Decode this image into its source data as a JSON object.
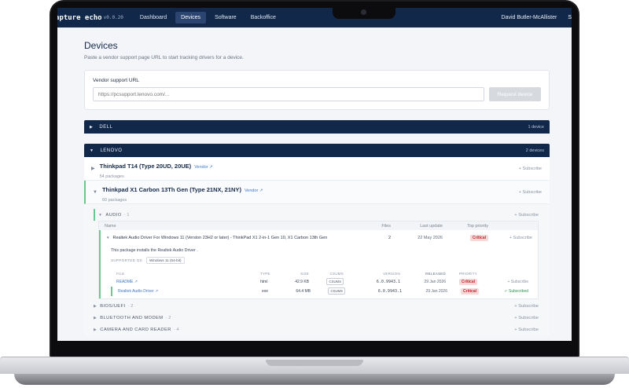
{
  "nav": {
    "brand": "apture echo",
    "version": "v0.0.20",
    "links": [
      "Dashboard",
      "Devices",
      "Software",
      "Backoffice"
    ],
    "active": "Devices",
    "user": "David Butler-McAllister",
    "user_extra": "S"
  },
  "page": {
    "title": "Devices",
    "subtitle": "Paste a vendor support page URL to start tracking drivers for a device."
  },
  "url_card": {
    "label": "Vendor support URL",
    "placeholder": "https://pcsupport.lenovo.com/...",
    "button": "Request device"
  },
  "vendors": [
    {
      "name": "DELL",
      "count": "1 device",
      "expanded": false
    },
    {
      "name": "LENOVO",
      "count": "2 devices",
      "expanded": true
    }
  ],
  "models": [
    {
      "name": "Thinkpad T14 (Type 20UD, 20UE)",
      "vendor_link": "Vendor ↗",
      "packages": "54 packages",
      "subscribe": "+ Subscribe"
    },
    {
      "name": "Thinkpad X1 Carbon 13Th Gen (Type 21NX, 21NY)",
      "vendor_link": "Vendor ↗",
      "packages": "60 packages",
      "subscribe": "+ Subscribe"
    }
  ],
  "categories": [
    {
      "name": "AUDIO",
      "count": "· 1",
      "subscribe": "+ Subscribe"
    },
    {
      "name": "BIOS/UEFI",
      "count": "· 2",
      "subscribe": "+ Subscribe"
    },
    {
      "name": "BLUETOOTH AND MODEM",
      "count": "· 2",
      "subscribe": "+ Subscribe"
    },
    {
      "name": "CAMERA AND CARD READER",
      "count": "· 4",
      "subscribe": "+ Subscribe"
    }
  ],
  "package_table": {
    "headers": {
      "name": "Name",
      "files": "Files",
      "last_update": "Last update",
      "priority": "Top priority"
    },
    "package": {
      "name": "Realtek Audio Driver For Windows 11 (Version 23H2 or later) - ThinkPad X1 2-in-1 Gen 10, X1 Carbon 13th Gen",
      "files": "2",
      "last_update": "22 May 2026",
      "priority": "Critical",
      "subscribe": "+ Subscribe",
      "description": "This package installs the Realtek Audio Driver .",
      "supported_label": "SUPPORTED OS",
      "supported_os": "Windows 11 (64-bit)"
    },
    "file_headers": {
      "file": "FILE",
      "type": "TYPE",
      "size": "SIZE",
      "csums": "CSUMS",
      "version": "VERSION",
      "released": "RELEASED",
      "priority": "PRIORITY"
    },
    "files": [
      {
        "name": "README ↗",
        "type": "html",
        "size": "42.9 KB",
        "csums": "CSUMS",
        "version": "6.0.9943.1",
        "released": "29 Jan 2026",
        "priority": "Critical",
        "subscribe": "+ Subscribe"
      },
      {
        "name": "Realtek Audio Driver ↗",
        "type": "exe",
        "size": "64.4 MB",
        "csums": "CSUMS",
        "version": "6.0.9943.1",
        "released": "29 Jan 2026",
        "priority": "Critical",
        "subscribe": "✓ Subscribed"
      }
    ]
  },
  "colors": {
    "nav_bg": "#12284a",
    "accent_green": "#6bc78e",
    "critical": "#c2262b",
    "link": "#3d78c9"
  }
}
